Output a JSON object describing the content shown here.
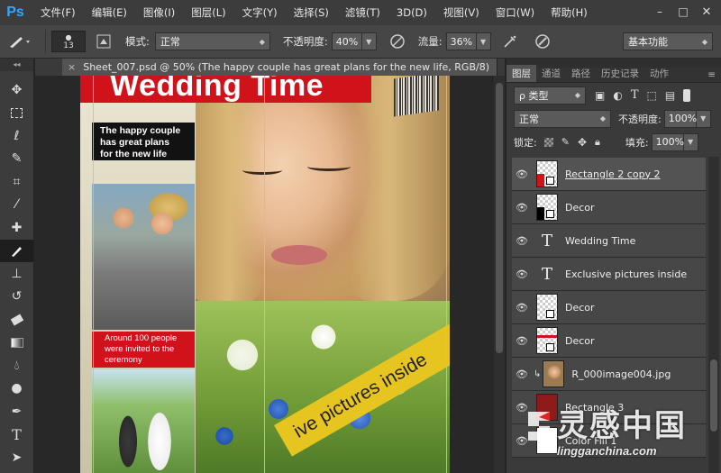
{
  "menubar": {
    "logo": "Ps",
    "items": [
      "文件(F)",
      "编辑(E)",
      "图像(I)",
      "图层(L)",
      "文字(Y)",
      "选择(S)",
      "滤镜(T)",
      "3D(D)",
      "视图(V)",
      "窗口(W)",
      "帮助(H)"
    ],
    "window_buttons": [
      "–",
      "□",
      "✕"
    ]
  },
  "options": {
    "brush_size": "13",
    "mode_label": "模式:",
    "mode_value": "正常",
    "opacity_label": "不透明度:",
    "opacity_value": "40%",
    "flow_label": "流量:",
    "flow_value": "36%",
    "workspace": "基本功能"
  },
  "document": {
    "tab_title": "Sheet_007.psd @ 50% (The happy couple  has great plans  for the new life, RGB/8)",
    "close": "×",
    "banner_title": "Wedding Time",
    "caption_top": [
      "The happy couple",
      "has great plans",
      "for the new life"
    ],
    "caption_red": [
      "Around 100 people",
      "were invited to the",
      "ceremony"
    ],
    "band_text": "ive pictures inside"
  },
  "panel": {
    "tabs": [
      "图层",
      "通道",
      "路径",
      "历史记录",
      "动作"
    ],
    "filter_kind": "ρ 类型",
    "blend_mode": "正常",
    "opacity_label": "不透明度:",
    "opacity_value": "100%",
    "lock_label": "锁定:",
    "fill_label": "填充:",
    "fill_value": "100%",
    "layers": [
      {
        "name": "Rectangle 2 copy 2"
      },
      {
        "name": "Decor"
      },
      {
        "name": "Wedding Time"
      },
      {
        "name": "Exclusive pictures inside"
      },
      {
        "name": "Decor"
      },
      {
        "name": "Decor"
      },
      {
        "name": "R_000image004.jpg"
      },
      {
        "name": "Rectangle 3"
      },
      {
        "name": "Color Fill 1"
      }
    ]
  },
  "watermark": {
    "title": "灵感中国",
    "url": "lingganchina.com"
  },
  "colors": {
    "accent_red": "#d0121b",
    "band_yellow": "#e7c520",
    "guide_cyan": "#6fe0e0"
  }
}
